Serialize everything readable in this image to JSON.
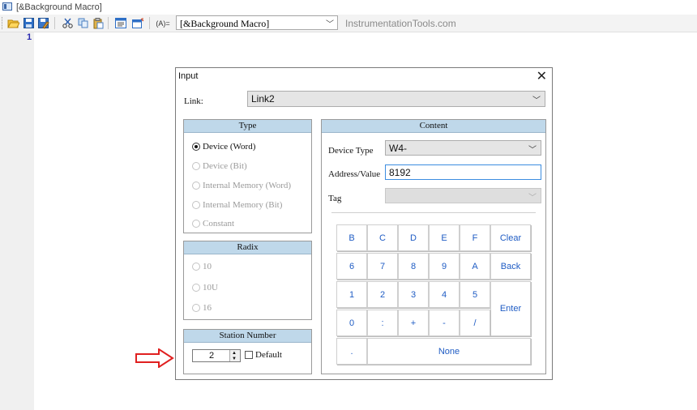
{
  "window": {
    "title": "[&Background Macro]"
  },
  "toolbar": {
    "macro_select": "[&Background Macro]",
    "watermark": "InstrumentationTools.com"
  },
  "editor": {
    "line_number": "1"
  },
  "dialog": {
    "title": "Input",
    "close": "✕",
    "link_label": "Link:",
    "link_value": "Link2",
    "type": {
      "title": "Type",
      "options": [
        {
          "label": "Device (Word)",
          "selected": true,
          "enabled": true
        },
        {
          "label": "Device (Bit)",
          "selected": false,
          "enabled": false
        },
        {
          "label": "Internal Memory (Word)",
          "selected": false,
          "enabled": false
        },
        {
          "label": "Internal Memory (Bit)",
          "selected": false,
          "enabled": false
        },
        {
          "label": "Constant",
          "selected": false,
          "enabled": false
        }
      ]
    },
    "radix": {
      "title": "Radix",
      "options": [
        {
          "label": "10",
          "selected": false,
          "enabled": false
        },
        {
          "label": "10U",
          "selected": false,
          "enabled": false
        },
        {
          "label": "16",
          "selected": false,
          "enabled": false
        }
      ]
    },
    "station": {
      "title": "Station Number",
      "value": "2",
      "default_label": "Default",
      "default_checked": false
    },
    "content": {
      "title": "Content",
      "device_type_label": "Device Type",
      "device_type_value": "W4-",
      "address_label": "Address/Value",
      "address_value": "8192",
      "tag_label": "Tag",
      "tag_value": ""
    },
    "keypad": {
      "row1": [
        "B",
        "C",
        "D",
        "E",
        "F",
        "Clear"
      ],
      "row2": [
        "6",
        "7",
        "8",
        "9",
        "A",
        "Back"
      ],
      "row3": [
        "1",
        "2",
        "3",
        "4",
        "5"
      ],
      "row4": [
        "0",
        ":",
        "+",
        "-",
        "/"
      ],
      "enter": "Enter",
      "dot": ".",
      "none": "None"
    }
  },
  "colors": {
    "group_header": "#bfd8ea",
    "key_text": "#1f5cc4",
    "arrow": "#e02020",
    "input_focus": "#3c8de0"
  }
}
